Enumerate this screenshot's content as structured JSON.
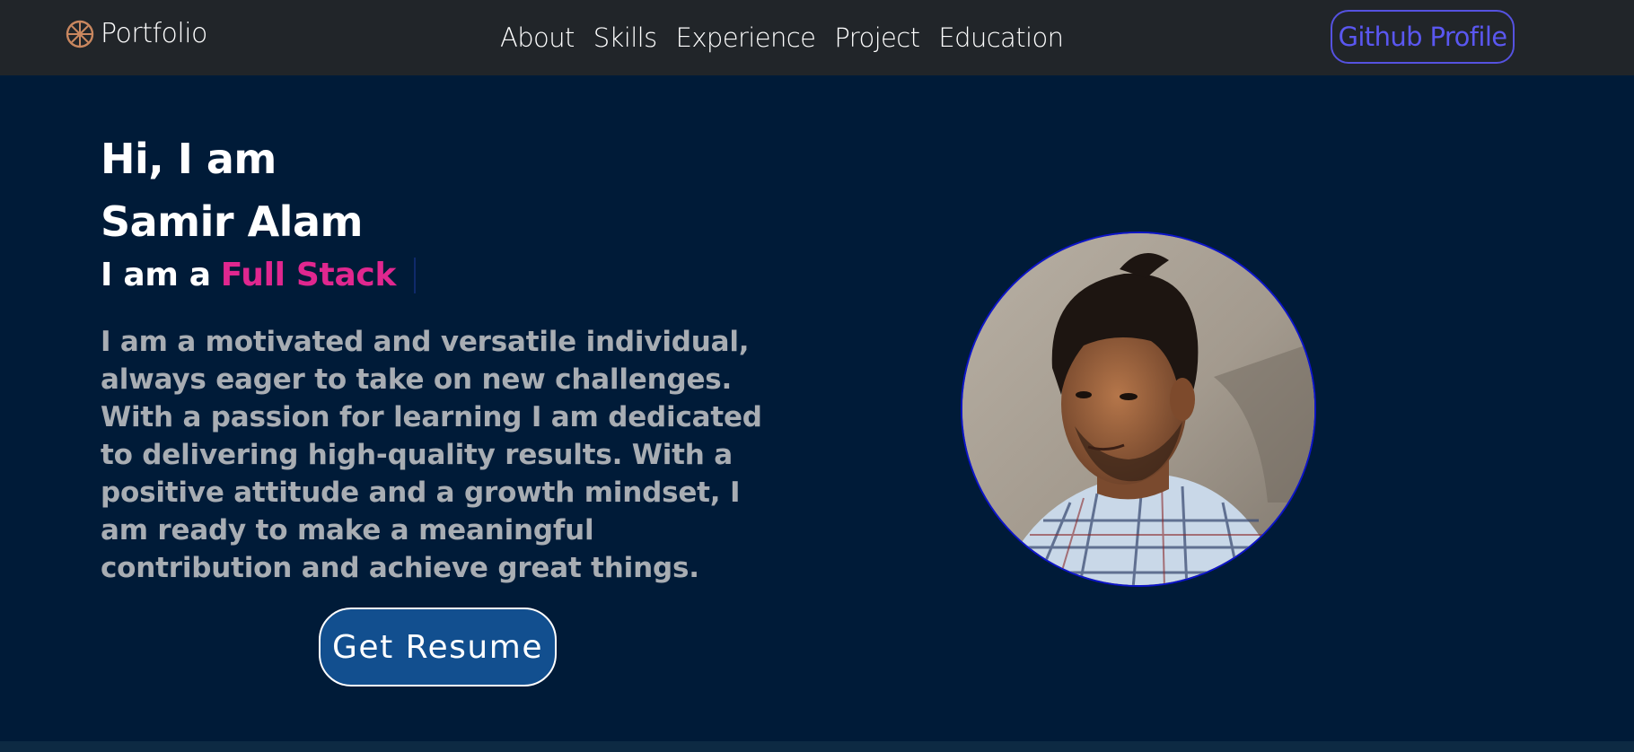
{
  "nav": {
    "brand": "Portfolio",
    "links": [
      "About",
      "Skills",
      "Experience",
      "Project",
      "Education"
    ],
    "github_button": "Github Profile"
  },
  "hero": {
    "greeting": "Hi, I am",
    "name": "Samir Alam",
    "role_prefix": "I am a",
    "role_highlight": "Full Stack",
    "description": "I am a motivated and versatile individual, always eager to take on new challenges. With a passion for learning I am dedicated to delivering high-quality results. With a positive attitude and a growth mindset, I am ready to make a meaningful contribution and achieve great things.",
    "resume_button": "Get Resume"
  },
  "colors": {
    "navbar_bg": "#212529",
    "page_bg": "#001b38",
    "accent_pink": "#e0278f",
    "github_outline": "#5552e0",
    "resume_button_bg": "#124f8f",
    "avatar_border": "#0c14c8"
  },
  "icons": {
    "brand": "wheel-logo-icon",
    "profile_image": "profile-photo"
  }
}
